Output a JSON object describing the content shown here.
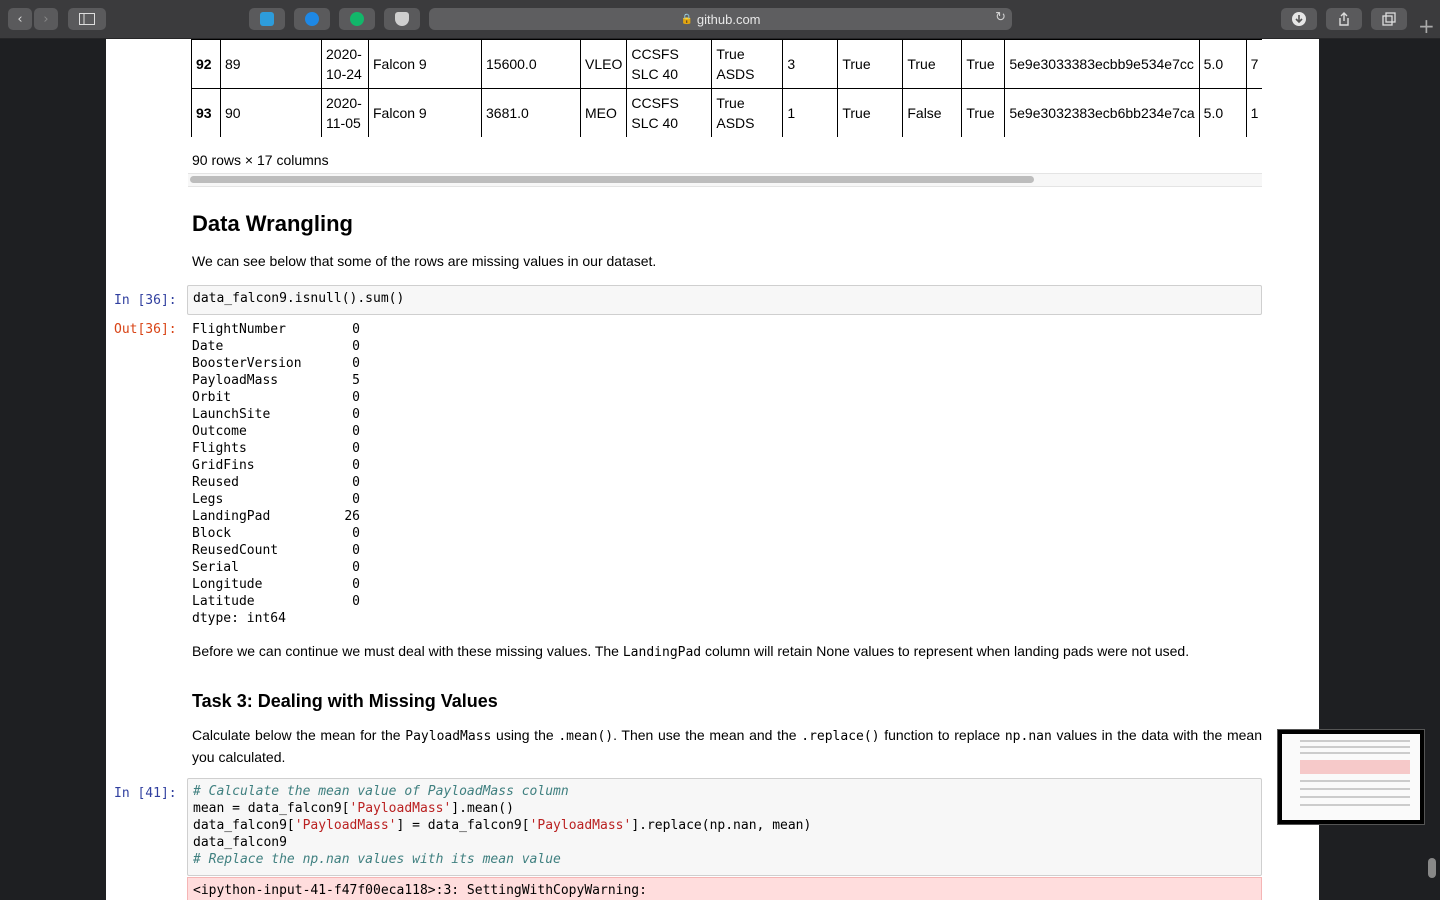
{
  "browser": {
    "url": "github.com",
    "lock_icon": "🔒",
    "back": "‹",
    "forward": "›"
  },
  "table": {
    "rows": [
      {
        "index": "92",
        "flight": "89",
        "date": "2020-10-24",
        "booster": "Falcon 9",
        "payload": "15600.0",
        "orbit": "VLEO",
        "site": "CCSFS SLC 40",
        "outcome": "True ASDS",
        "flights": "3",
        "gridfins": "True",
        "reused": "True",
        "legs": "True",
        "pad": "5e9e3033383ecbb9e534e7cc",
        "block": "5.0",
        "reusedcount": "7"
      },
      {
        "index": "93",
        "flight": "90",
        "date": "2020-11-05",
        "booster": "Falcon 9",
        "payload": "3681.0",
        "orbit": "MEO",
        "site": "CCSFS SLC 40",
        "outcome": "True ASDS",
        "flights": "1",
        "gridfins": "True",
        "reused": "False",
        "legs": "True",
        "pad": "5e9e3032383ecb6bb234e7ca",
        "block": "5.0",
        "reusedcount": "1"
      }
    ],
    "shape": "90 rows × 17 columns"
  },
  "section": {
    "title": "Data Wrangling",
    "intro": "We can see below that some of the rows are missing values in our dataset."
  },
  "cell36": {
    "in_prompt": "In [36]:",
    "out_prompt": "Out[36]:",
    "code": "data_falcon9.isnull().sum()",
    "output": [
      {
        "k": "FlightNumber",
        "v": "0"
      },
      {
        "k": "Date",
        "v": "0"
      },
      {
        "k": "BoosterVersion",
        "v": "0"
      },
      {
        "k": "PayloadMass",
        "v": "5"
      },
      {
        "k": "Orbit",
        "v": "0"
      },
      {
        "k": "LaunchSite",
        "v": "0"
      },
      {
        "k": "Outcome",
        "v": "0"
      },
      {
        "k": "Flights",
        "v": "0"
      },
      {
        "k": "GridFins",
        "v": "0"
      },
      {
        "k": "Reused",
        "v": "0"
      },
      {
        "k": "Legs",
        "v": "0"
      },
      {
        "k": "LandingPad",
        "v": "26"
      },
      {
        "k": "Block",
        "v": "0"
      },
      {
        "k": "ReusedCount",
        "v": "0"
      },
      {
        "k": "Serial",
        "v": "0"
      },
      {
        "k": "Longitude",
        "v": "0"
      },
      {
        "k": "Latitude",
        "v": "0"
      }
    ],
    "dtype": "dtype: int64"
  },
  "note": {
    "pre": "Before we can continue we must deal with these missing values. The ",
    "code": "LandingPad",
    "post": " column will retain None values to represent when landing pads were not used."
  },
  "task3": {
    "title": "Task 3: Dealing with Missing Values",
    "p1": "Calculate below the mean for the ",
    "c1": "PayloadMass",
    "p2": " using the ",
    "c2": ".mean()",
    "p3": ". Then use the mean and the ",
    "c3": ".replace()",
    "p4": " function to replace ",
    "c4": "np.nan",
    "p5": " values in the data with the mean you calculated."
  },
  "cell41": {
    "in_prompt": "In [41]:",
    "line1_comment": "# Calculate the mean value of PayloadMass column",
    "line2_a": "mean = data_falcon9[",
    "line2_str": "'PayloadMass'",
    "line2_b": "].mean()",
    "line3_a": "data_falcon9[",
    "line3_str1": "'PayloadMass'",
    "line3_b": "] = data_falcon9[",
    "line3_str2": "'PayloadMass'",
    "line3_c": "].replace(np.nan, mean)",
    "line4": "data_falcon9",
    "line5_comment": "# Replace the np.nan values with its mean value",
    "warning": "<ipython-input-41-f47f00eca118>:3: SettingWithCopyWarning:"
  }
}
